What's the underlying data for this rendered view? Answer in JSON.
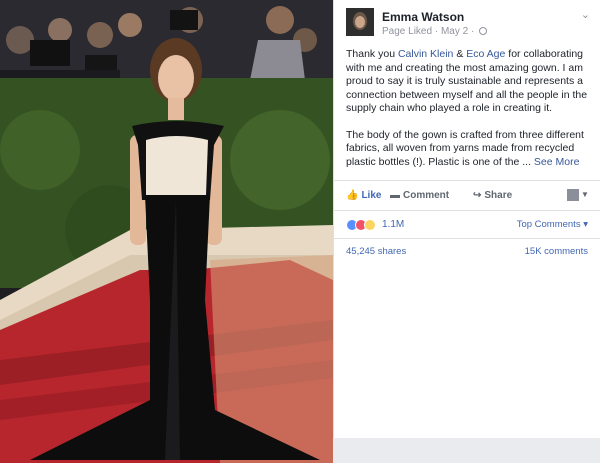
{
  "post": {
    "author": "Emma Watson",
    "page_status": "Page Liked",
    "date": "May 2",
    "body": {
      "p1_pre": "Thank you ",
      "p1_link1": "Calvin Klein",
      "p1_amp": " & ",
      "p1_link2": "Eco Age",
      "p1_post": " for collaborating with me and creating the most amazing gown. I am proud to say it is truly sustainable and represents a connection between myself and all the people in the supply chain who played a role in creating it.",
      "p2": "The body of the gown is crafted from three different fabrics, all woven from yarns made from recycled plastic bottles (!). Plastic is one of the ... ",
      "see_more": "See More"
    }
  },
  "actions": {
    "like": "Like",
    "comment": "Comment",
    "share": "Share"
  },
  "stats": {
    "reactions_count": "1.1M",
    "top_comments": "Top Comments",
    "shares": "45,245 shares",
    "comments": "15K comments"
  },
  "icons": {
    "menu": "chevron-down-icon",
    "like": "thumbs-up-icon",
    "comment": "speech-bubble-icon",
    "share": "share-arrow-icon",
    "privacy": "globe-icon"
  },
  "colors": {
    "link": "#365899",
    "accent": "#4267b2",
    "background": "#e9ebee"
  }
}
